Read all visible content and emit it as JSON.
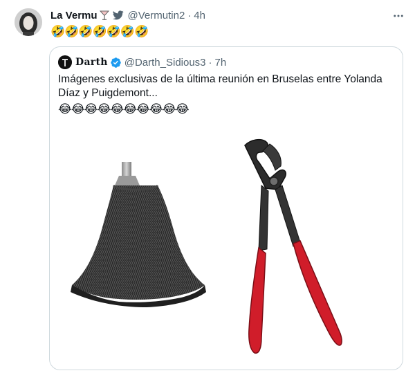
{
  "tweet": {
    "author_name": "La Vermu",
    "name_emoji": "cocktail-glass-icon",
    "handle": "@Vermutin2",
    "separator": "·",
    "time": "4h",
    "text": "🤣🤣🤣🤣🤣🤣🤣"
  },
  "quote": {
    "author_name": "Darth",
    "verified": true,
    "handle": "@Darth_Sidious3",
    "separator": "·",
    "time": "7h",
    "text": "Imágenes exclusivas de la última reunión en Bruselas entre Yolanda Díaz y Puigdemont...",
    "emojis": "😂😂😂😂😂😂😂😂😂😂",
    "media": [
      "mop-head-image",
      "pliers-image"
    ]
  },
  "colors": {
    "text": "#0f1419",
    "secondary": "#536471",
    "twitter_blue": "#1d9bf0",
    "border": "#cfd9de",
    "pliers_handle": "#d01d2a"
  }
}
